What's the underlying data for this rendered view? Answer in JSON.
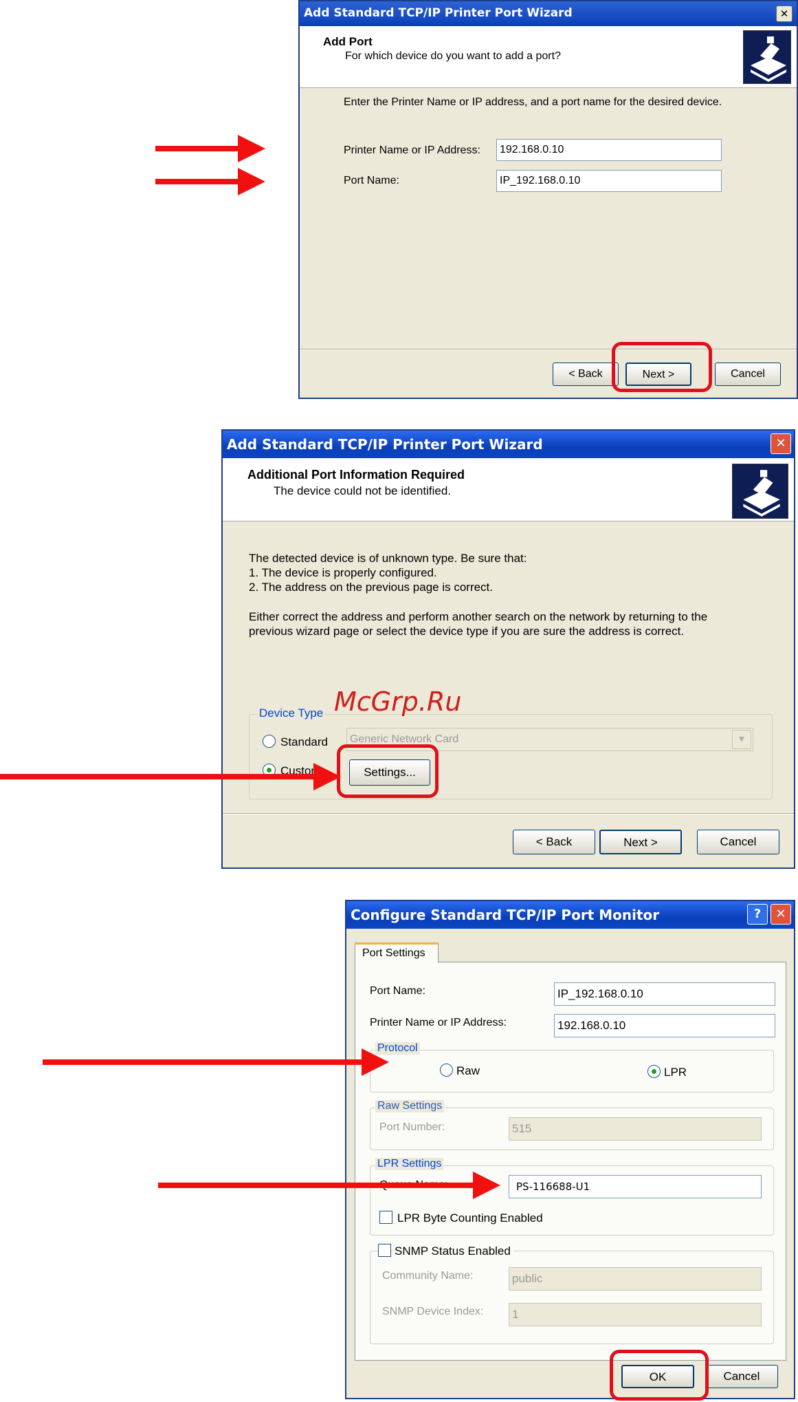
{
  "wizard1": {
    "title": "Add Standard TCP/IP Printer Port Wizard",
    "close_glyph": "✕",
    "header_title": "Add Port",
    "header_subtitle": "For which device do you want to add a port?",
    "instruction": "Enter the Printer Name or IP address, and a port name for the desired device.",
    "printer_label": "Printer Name or IP Address:",
    "printer_value": "192.168.0.10",
    "port_label": "Port Name:",
    "port_value": "IP_192.168.0.10",
    "back_label": "< Back",
    "next_label": "Next >",
    "cancel_label": "Cancel"
  },
  "wizard2": {
    "title": "Add Standard TCP/IP Printer Port Wizard",
    "close_glyph": "✕",
    "header_title": "Additional Port Information Required",
    "header_subtitle": "The device could not be identified.",
    "body_line1": "The detected device is of unknown type.  Be sure that:",
    "body_line2": "1. The device is properly configured.",
    "body_line3": "2.  The address on the previous page is correct.",
    "body_line4": "Either correct the address and perform another search on the network by returning to the",
    "body_line5": "previous wizard page or select the device type if you are sure the address is correct.",
    "device_type_label": "Device Type",
    "standard_label": "Standard",
    "standard_value": "Generic Network Card",
    "custom_label": "Custom",
    "settings_label": "Settings...",
    "back_label": "< Back",
    "next_label": "Next >",
    "cancel_label": "Cancel"
  },
  "monitor": {
    "title": "Configure Standard TCP/IP Port Monitor",
    "help_glyph": "?",
    "close_glyph": "✕",
    "tab_label": "Port Settings",
    "port_name_label": "Port Name:",
    "port_name_value": "IP_192.168.0.10",
    "printer_label": "Printer Name or IP Address:",
    "printer_value": "192.168.0.10",
    "protocol_label": "Protocol",
    "raw_label": "Raw",
    "lpr_label": "LPR",
    "raw_settings_label": "Raw Settings",
    "port_number_label": "Port Number:",
    "port_number_value": "515",
    "lpr_settings_label": "LPR Settings",
    "queue_name_label": "Queue Name:",
    "queue_name_value": "PS-116688-U1",
    "byte_counting_label": "LPR Byte Counting Enabled",
    "snmp_label": "SNMP Status Enabled",
    "community_label": "Community Name:",
    "community_value": "public",
    "device_index_label": "SNMP Device Index:",
    "device_index_value": "1",
    "ok_label": "OK",
    "cancel_label": "Cancel"
  },
  "watermark": "McGrp.Ru",
  "colors": {
    "title_blue": "#0a3fb8",
    "highlight_red": "#e0101a",
    "arrow_red": "#f01010",
    "xp_face": "#ece9d8"
  }
}
